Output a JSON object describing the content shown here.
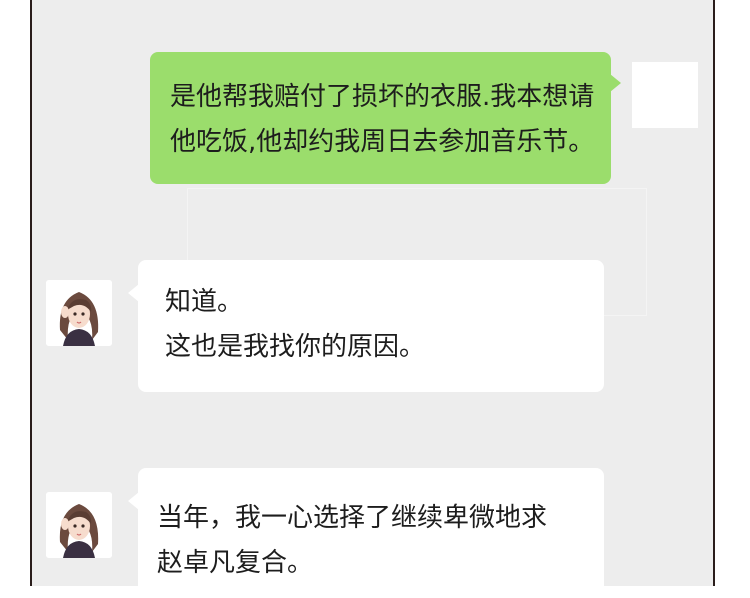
{
  "chat": {
    "messages": [
      {
        "sender": "me",
        "lines": [
          "是他帮我赔付了损坏的衣服.我本想请",
          "他吃饭,他却约我周日去参加音乐节。"
        ]
      },
      {
        "sender": "friend",
        "lines": [
          "知道。",
          "这也是我找你的原因。"
        ]
      },
      {
        "sender": "friend",
        "lines": [
          "当年，我一心选择了继续卑微地求",
          "赵卓凡复合。"
        ]
      }
    ]
  },
  "colors": {
    "background": "#ededed",
    "my_bubble": "#9bdd6c",
    "friend_bubble": "#ffffff",
    "frame_border": "#2a1d1b"
  },
  "icons": {
    "my_avatar": "blank-avatar-icon",
    "friend_avatar": "girl-portrait-avatar"
  }
}
